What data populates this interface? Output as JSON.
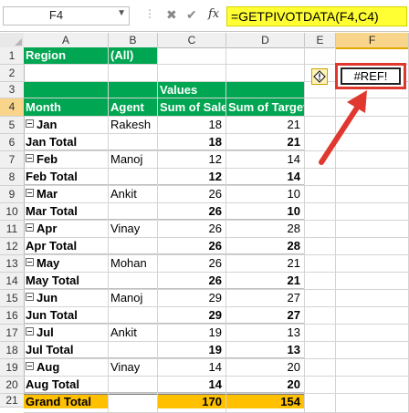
{
  "formula_bar": {
    "name_box": "F4",
    "dots": "⋮",
    "cancel_glyph": "✖",
    "enter_glyph": "✔",
    "fx_label": "fx",
    "formula": "=GETPIVOTDATA(F4,C4)"
  },
  "columns": [
    "A",
    "B",
    "C",
    "D",
    "E",
    "F"
  ],
  "active_cell": "F4",
  "rows": [
    "1",
    "2",
    "3",
    "4",
    "5",
    "6",
    "7",
    "8",
    "9",
    "10",
    "11",
    "12",
    "13",
    "14",
    "15",
    "16",
    "17",
    "18",
    "19",
    "20",
    "21"
  ],
  "pivot": {
    "filter_label": "Region",
    "filter_value": "(All)",
    "values_label": "Values",
    "headers": {
      "month": "Month",
      "agent": "Agent",
      "sales": "Sum of Sales",
      "target": "Sum of Target"
    },
    "body": [
      {
        "type": "item",
        "label": "Jan",
        "agent": "Rakesh",
        "sales": "18",
        "target": "21"
      },
      {
        "type": "total",
        "label": "Jan Total",
        "agent": "",
        "sales": "18",
        "target": "21"
      },
      {
        "type": "item",
        "label": "Feb",
        "agent": "Manoj",
        "sales": "12",
        "target": "14"
      },
      {
        "type": "total",
        "label": "Feb Total",
        "agent": "",
        "sales": "12",
        "target": "14"
      },
      {
        "type": "item",
        "label": "Mar",
        "agent": "Ankit",
        "sales": "26",
        "target": "10"
      },
      {
        "type": "total",
        "label": "Mar Total",
        "agent": "",
        "sales": "26",
        "target": "10"
      },
      {
        "type": "item",
        "label": "Apr",
        "agent": "Vinay",
        "sales": "26",
        "target": "28"
      },
      {
        "type": "total",
        "label": "Apr Total",
        "agent": "",
        "sales": "26",
        "target": "28"
      },
      {
        "type": "item",
        "label": "May",
        "agent": "Mohan",
        "sales": "26",
        "target": "21"
      },
      {
        "type": "total",
        "label": "May Total",
        "agent": "",
        "sales": "26",
        "target": "21"
      },
      {
        "type": "item",
        "label": "Jun",
        "agent": "Manoj",
        "sales": "29",
        "target": "27"
      },
      {
        "type": "total",
        "label": "Jun Total",
        "agent": "",
        "sales": "29",
        "target": "27"
      },
      {
        "type": "item",
        "label": "Jul",
        "agent": "Ankit",
        "sales": "19",
        "target": "13"
      },
      {
        "type": "total",
        "label": "Jul Total",
        "agent": "",
        "sales": "19",
        "target": "13"
      },
      {
        "type": "item",
        "label": "Aug",
        "agent": "Vinay",
        "sales": "14",
        "target": "20"
      },
      {
        "type": "total",
        "label": "Aug Total",
        "agent": "",
        "sales": "14",
        "target": "20"
      },
      {
        "type": "grand",
        "label": "Grand Total",
        "agent": "",
        "sales": "170",
        "target": "154"
      }
    ]
  },
  "result_cell": "#REF!",
  "colors": {
    "pivot_header": "#00a651",
    "grand_total": "#ffc000",
    "formula_highlight": "#ffff33",
    "callout": "#e0382f",
    "active_header": "#f8d58b"
  }
}
